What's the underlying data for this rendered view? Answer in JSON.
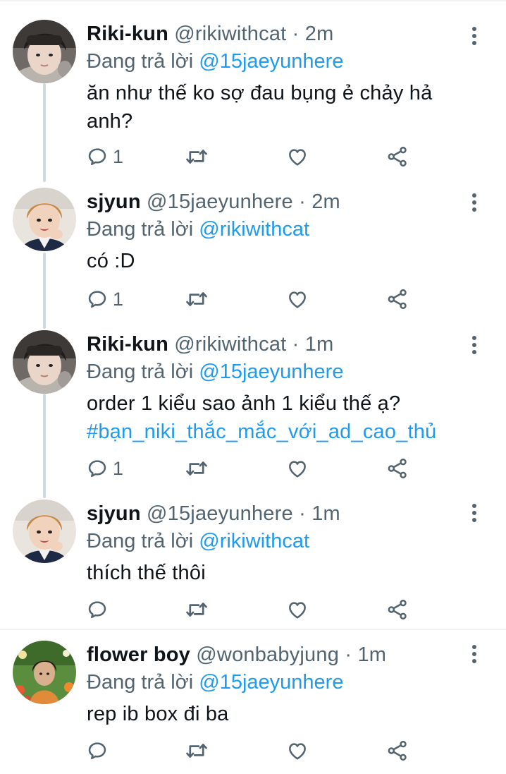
{
  "colors": {
    "link": "#1d9bf0",
    "text": "#0f1419",
    "secondary": "#536471",
    "thread_line": "#cfd9de"
  },
  "tweets": [
    {
      "display_name": "Riki-kun",
      "handle": "@rikiwithcat",
      "separator": "·",
      "time": "2m",
      "reply_prefix": "Đang trả lời",
      "reply_to": "@15jaeyunhere",
      "text": "ăn như thế ko sợ đau bụng ẻ chảy hả anh?",
      "hashtag": "",
      "reply_count": "1",
      "avatar_icon": "avatar-riki-icon"
    },
    {
      "display_name": "sjyun",
      "handle": "@15jaeyunhere",
      "separator": "·",
      "time": "2m",
      "reply_prefix": "Đang trả lời",
      "reply_to": "@rikiwithcat",
      "text": "có :D",
      "hashtag": "",
      "reply_count": "1",
      "avatar_icon": "avatar-sjyun-icon"
    },
    {
      "display_name": "Riki-kun",
      "handle": "@rikiwithcat",
      "separator": "·",
      "time": "1m",
      "reply_prefix": "Đang trả lời",
      "reply_to": "@15jaeyunhere",
      "text": "order 1 kiểu sao ảnh 1 kiểu thế ạ?",
      "hashtag": "#bạn_niki_thắc_mắc_với_ad_cao_thủ",
      "reply_count": "1",
      "avatar_icon": "avatar-riki-icon"
    },
    {
      "display_name": "sjyun",
      "handle": "@15jaeyunhere",
      "separator": "·",
      "time": "1m",
      "reply_prefix": "Đang trả lời",
      "reply_to": "@rikiwithcat",
      "text": "thích thế thôi",
      "hashtag": "",
      "reply_count": "",
      "avatar_icon": "avatar-sjyun-icon"
    },
    {
      "display_name": "flower boy",
      "handle": "@wonbabyjung",
      "separator": "·",
      "time": "1m",
      "reply_prefix": "Đang trả lời",
      "reply_to": "@15jaeyunhere",
      "text": "rep ib box đi ba",
      "hashtag": "",
      "reply_count": "",
      "avatar_icon": "avatar-flower-icon"
    }
  ]
}
